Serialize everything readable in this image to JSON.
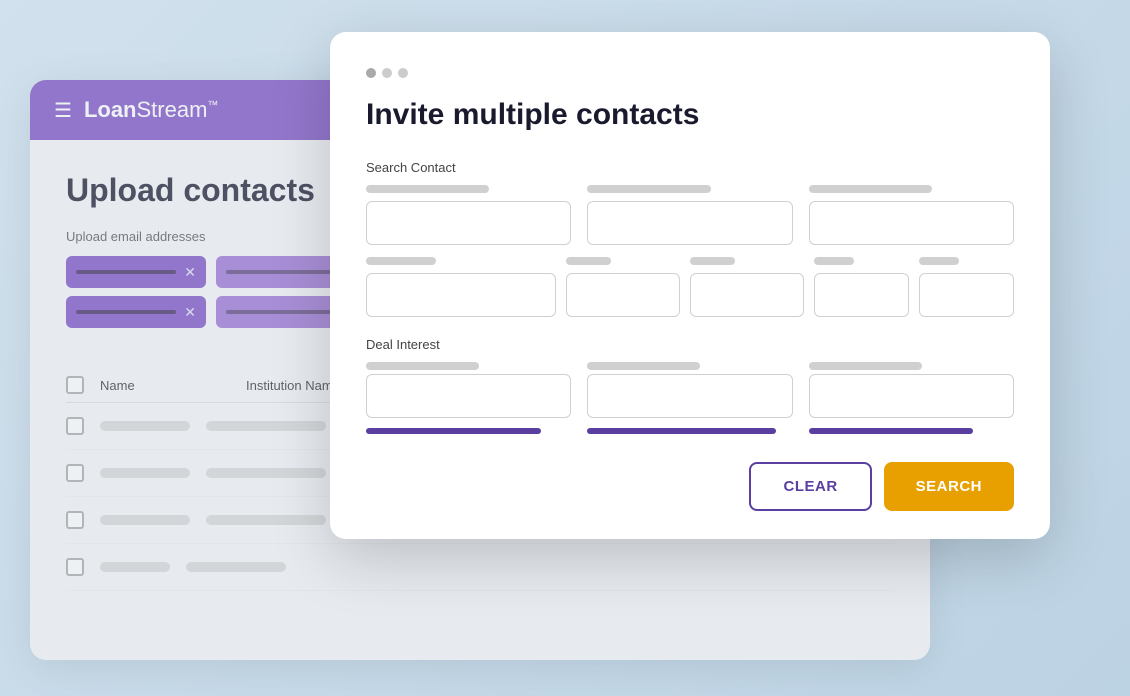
{
  "app": {
    "logo_bold": "Loan",
    "logo_regular": "Stream",
    "logo_tm": "™"
  },
  "bg_page": {
    "title": "Upload contacts",
    "section_label": "Upload email addresses"
  },
  "table": {
    "col_name": "Name",
    "col_institution": "Institution Name"
  },
  "modal": {
    "title": "Invite multiple contacts",
    "search_contact_label": "Search Contact",
    "deal_interest_label": "Deal Interest",
    "clear_button": "CLEAR",
    "search_button": "SEARCH"
  }
}
